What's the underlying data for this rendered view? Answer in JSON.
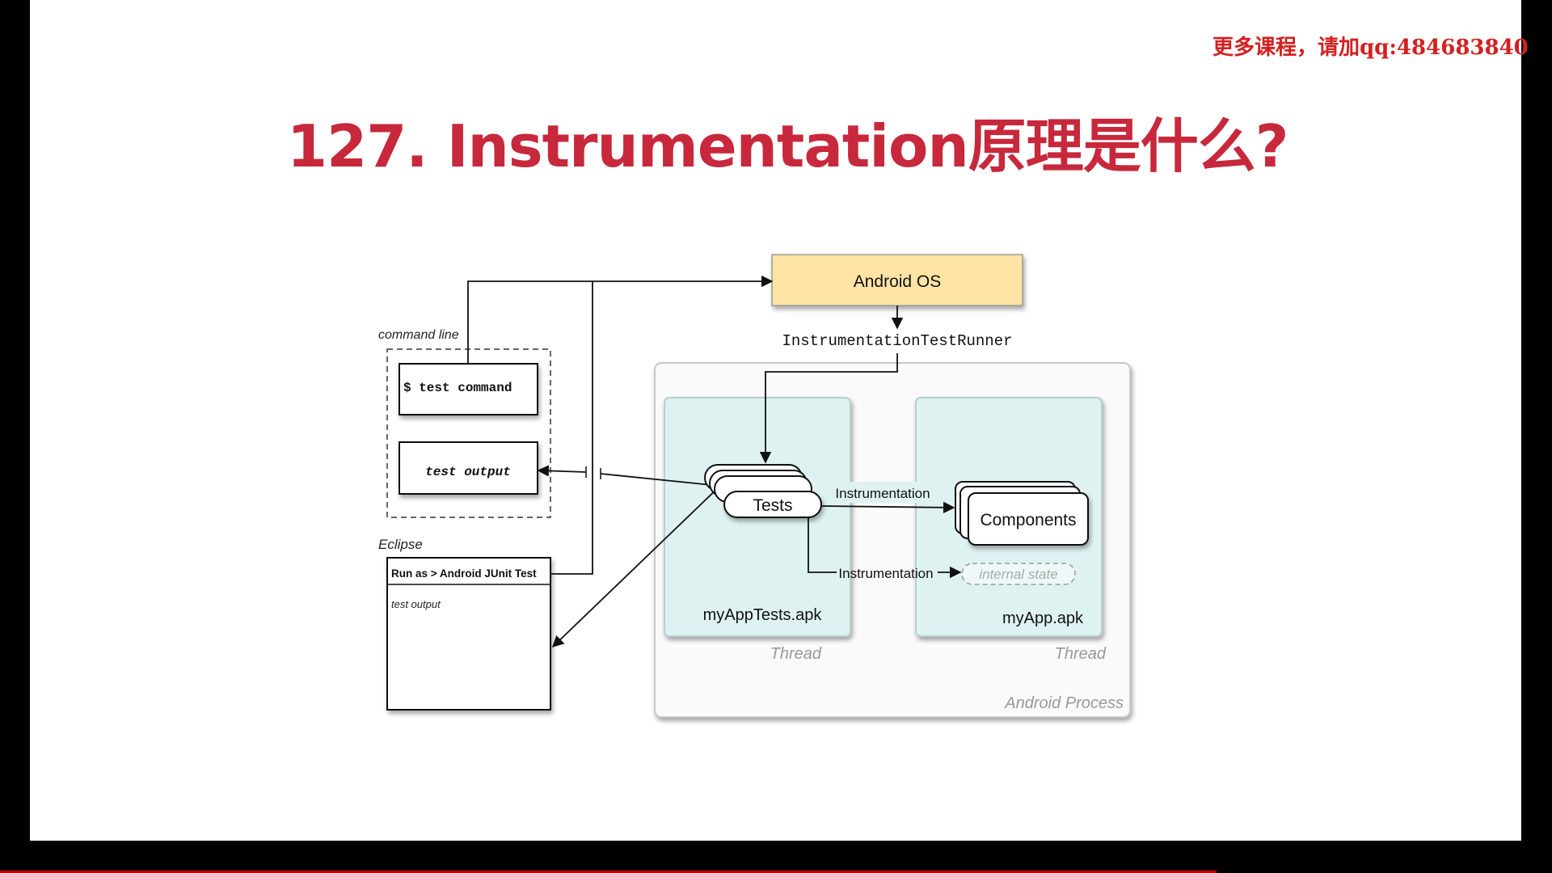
{
  "watermark": "更多课程，请加qq:484683840",
  "title": "127. Instrumentation原理是什么?",
  "diagram": {
    "android_os": "Android OS",
    "runner": "InstrumentationTestRunner",
    "command_line_label": "command line",
    "test_command": "$ test command",
    "test_output_cli": "test output",
    "eclipse_label": "Eclipse",
    "eclipse_run": "Run as > Android JUnit Test",
    "eclipse_output": "test output",
    "tests": "Tests",
    "components": "Components",
    "instrumentation_1": "Instrumentation",
    "instrumentation_2": "Instrumentation",
    "internal_state": "internal state",
    "tests_apk": "myAppTests.apk",
    "app_apk": "myApp.apk",
    "thread_1": "Thread",
    "thread_2": "Thread",
    "process": "Android Process"
  },
  "colors": {
    "title": "#c8283c",
    "watermark": "#d42020",
    "android_os_fill": "#fde3a4",
    "thread_fill": "#dff2f2"
  }
}
